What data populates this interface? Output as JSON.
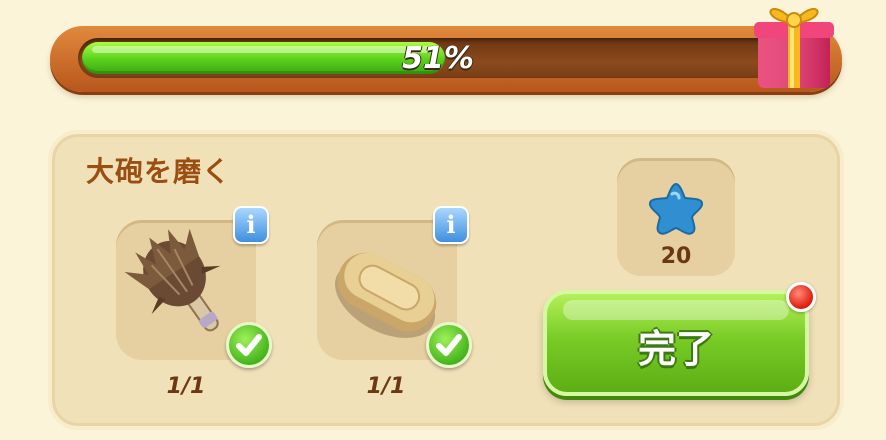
{
  "progress": {
    "percent_label": "51%",
    "fraction": 0.51
  },
  "task": {
    "title": "大砲を磨く",
    "items": [
      {
        "icon": "feather-duster-icon",
        "count": "1/1",
        "completed": true,
        "info_label": "i"
      },
      {
        "icon": "soap-bar-icon",
        "count": "1/1",
        "completed": true,
        "info_label": "i"
      }
    ],
    "reward": {
      "icon": "blue-star-icon",
      "value": "20"
    },
    "complete_button_label": "完了"
  },
  "colors": {
    "progress_green": "#59d11d",
    "button_green": "#79cc26",
    "title_brown": "#9a4e12",
    "notification_red": "#e32212"
  }
}
